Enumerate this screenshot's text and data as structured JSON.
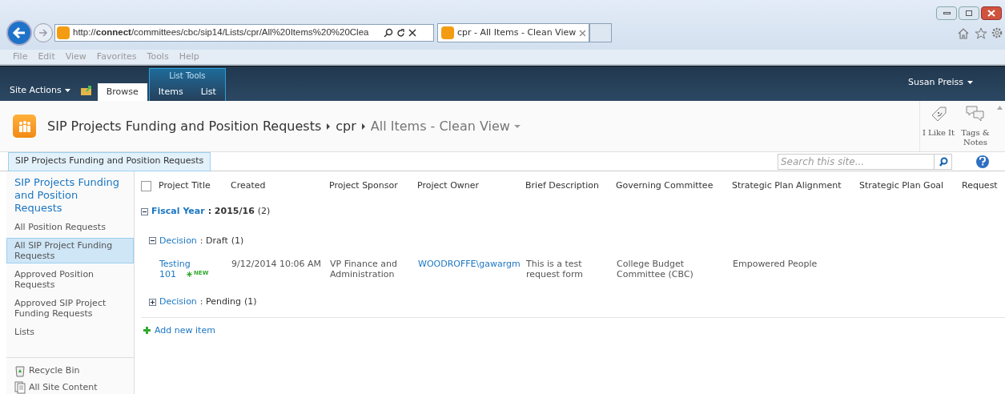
{
  "browser": {
    "url": "http://**connect**/committees/cbc/sip14/Lists/cpr/All%20Items%20%20Clea",
    "tab_title": "cpr - All Items - Clean View",
    "menu": [
      "File",
      "Edit",
      "View",
      "Favorites",
      "Tools",
      "Help"
    ]
  },
  "ribbon": {
    "site_actions": "Site Actions",
    "context_group": "List Tools",
    "tabs": [
      {
        "label": "Browse",
        "selected": true
      },
      {
        "label": "Items",
        "selected": false
      },
      {
        "label": "List",
        "selected": false
      }
    ],
    "user": "Susan Preiss"
  },
  "header": {
    "breadcrumb": [
      "SIP Projects Funding and Position Requests",
      "cpr",
      "All Items - Clean View"
    ],
    "actions": [
      {
        "kind": "like",
        "label": "I Like It"
      },
      {
        "kind": "tags",
        "label": "Tags & Notes"
      }
    ]
  },
  "top_link": "SIP Projects Funding and Position Requests",
  "search": {
    "placeholder": "Search this site..."
  },
  "nav": {
    "title": "SIP Projects Funding and Position Requests",
    "items": [
      {
        "label": "All Position Requests",
        "selected": false
      },
      {
        "label": "All SIP Project Funding Requests",
        "selected": true
      },
      {
        "label": "Approved Position Requests",
        "selected": false
      },
      {
        "label": "Approved SIP Project Funding Requests",
        "selected": false
      },
      {
        "label": "Lists",
        "selected": false
      }
    ],
    "footer": [
      {
        "kind": "recycle",
        "label": "Recycle Bin"
      },
      {
        "kind": "content",
        "label": "All Site Content"
      }
    ]
  },
  "list": {
    "columns": [
      "Project Title",
      "Created",
      "Project Sponsor",
      "Project Owner",
      "Brief Description",
      "Governing Committee",
      "Strategic Plan Alignment",
      "Strategic Plan Goal",
      "Request"
    ],
    "select_all_checked": false,
    "groups": [
      {
        "field": "Fiscal Year",
        "value": ": 2015/16",
        "count": "(2)",
        "expanded": true,
        "children": [
          {
            "field": "Decision",
            "value": ": Draft",
            "count": "(1)",
            "expanded": true,
            "rows": [
              {
                "title": "Testing 101",
                "badge": "NEW",
                "created": "9/12/2014 10:06 AM",
                "sponsor": "VP Finance and Administration",
                "owner": "WOODROFFE\\gawargm",
                "description": "This is a test request form",
                "committee": "College Budget Committee (CBC)",
                "alignment": "Empowered People"
              }
            ]
          },
          {
            "field": "Decision",
            "value": ": Pending",
            "count": "(1)",
            "expanded": false
          }
        ]
      }
    ],
    "add_item": "Add new item"
  }
}
